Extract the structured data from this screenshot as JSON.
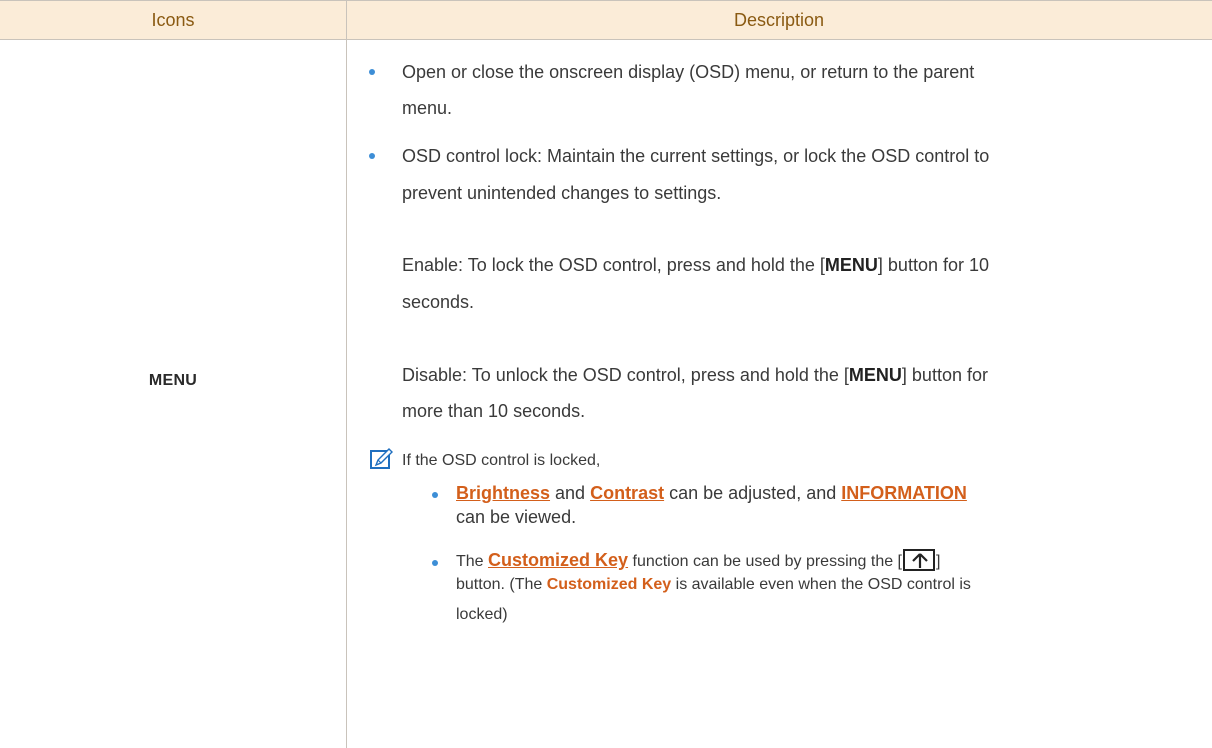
{
  "table": {
    "headers": {
      "icons": "Icons",
      "description": "Description"
    },
    "row": {
      "icon_label": "MENU",
      "bullets": [
        "Open or close the onscreen display (OSD) menu, or return to the parent",
        "menu.",
        "OSD control lock: Maintain the current settings, or lock the OSD control to",
        "prevent unintended changes to settings."
      ],
      "enable": {
        "prefix": "Enable: To lock the OSD control, press and hold the [",
        "key": "MENU",
        "suffix": "] button for 10",
        "line2": "seconds."
      },
      "disable": {
        "prefix": "Disable: To unlock the OSD control, press and hold the [",
        "key": "MENU",
        "suffix": "] button for",
        "line2": "more than 10 seconds."
      },
      "note": {
        "intro": "If the OSD control is locked,",
        "item1": {
          "link1": "Brightness",
          "and": " and ",
          "link2": "Contrast",
          "mid": " can be adjusted, and ",
          "link3": "INFORMATION",
          "line2": "can be viewed."
        },
        "item2": {
          "pre": "The ",
          "link": "Customized Key",
          "post": " function can be used by pressing the [",
          "close": "]",
          "line2_pre": "button. (The ",
          "line2_key": "Customized Key",
          "line2_post": " is available even when the OSD control is",
          "line3": "locked)"
        }
      }
    }
  },
  "icons": {
    "note": "note-pencil-icon",
    "key": "up-arrow-key-icon"
  },
  "colors": {
    "header_bg": "#fbecd8",
    "header_text": "#8a5a12",
    "bullet": "#3d8ed6",
    "link": "#d35f1b"
  }
}
